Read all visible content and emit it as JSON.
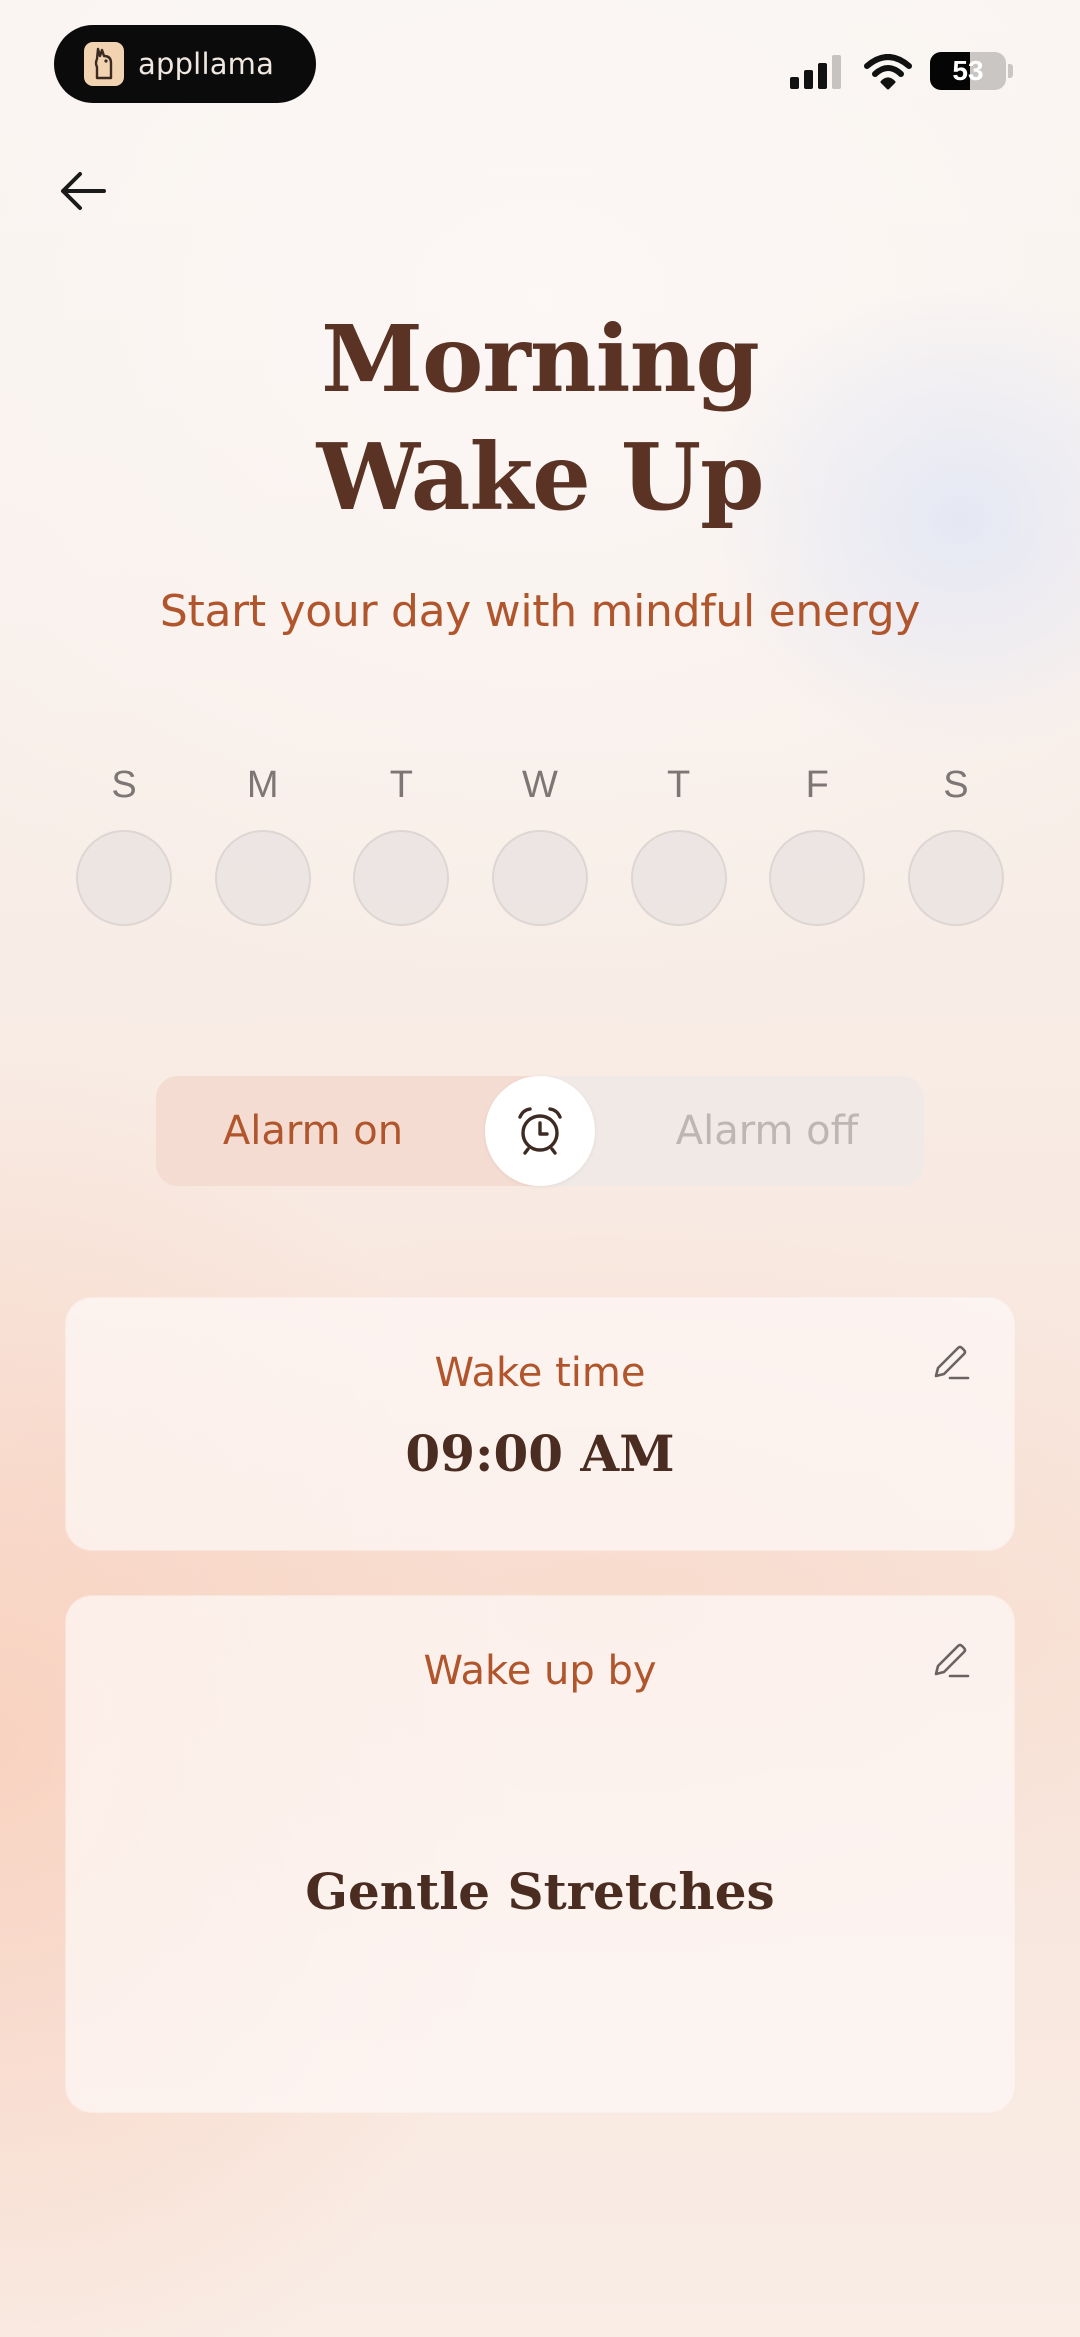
{
  "status_bar": {
    "brand": "appllama",
    "battery": "53",
    "battery_level": 0.53
  },
  "header": {
    "back_icon": "arrow-left-icon",
    "title_line1": "Morning",
    "title_line2": "Wake Up",
    "subtitle": "Start your day with mindful energy"
  },
  "days": [
    {
      "letter": "S",
      "selected": false
    },
    {
      "letter": "M",
      "selected": false
    },
    {
      "letter": "T",
      "selected": false
    },
    {
      "letter": "W",
      "selected": false
    },
    {
      "letter": "T",
      "selected": false
    },
    {
      "letter": "F",
      "selected": false
    },
    {
      "letter": "S",
      "selected": false
    }
  ],
  "alarm_toggle": {
    "on_label": "Alarm on",
    "off_label": "Alarm off",
    "state": "on",
    "icon": "alarm-clock-icon"
  },
  "wake_time_card": {
    "label": "Wake time",
    "value": "09:00 AM",
    "edit_icon": "pencil-icon"
  },
  "wake_by_card": {
    "label": "Wake up by",
    "value": "Gentle Stretches",
    "edit_icon": "pencil-icon"
  },
  "colors": {
    "title": "#5a3325",
    "accent": "#b1562c",
    "value_text": "#4b2c20",
    "muted": "#bcb6b4"
  }
}
